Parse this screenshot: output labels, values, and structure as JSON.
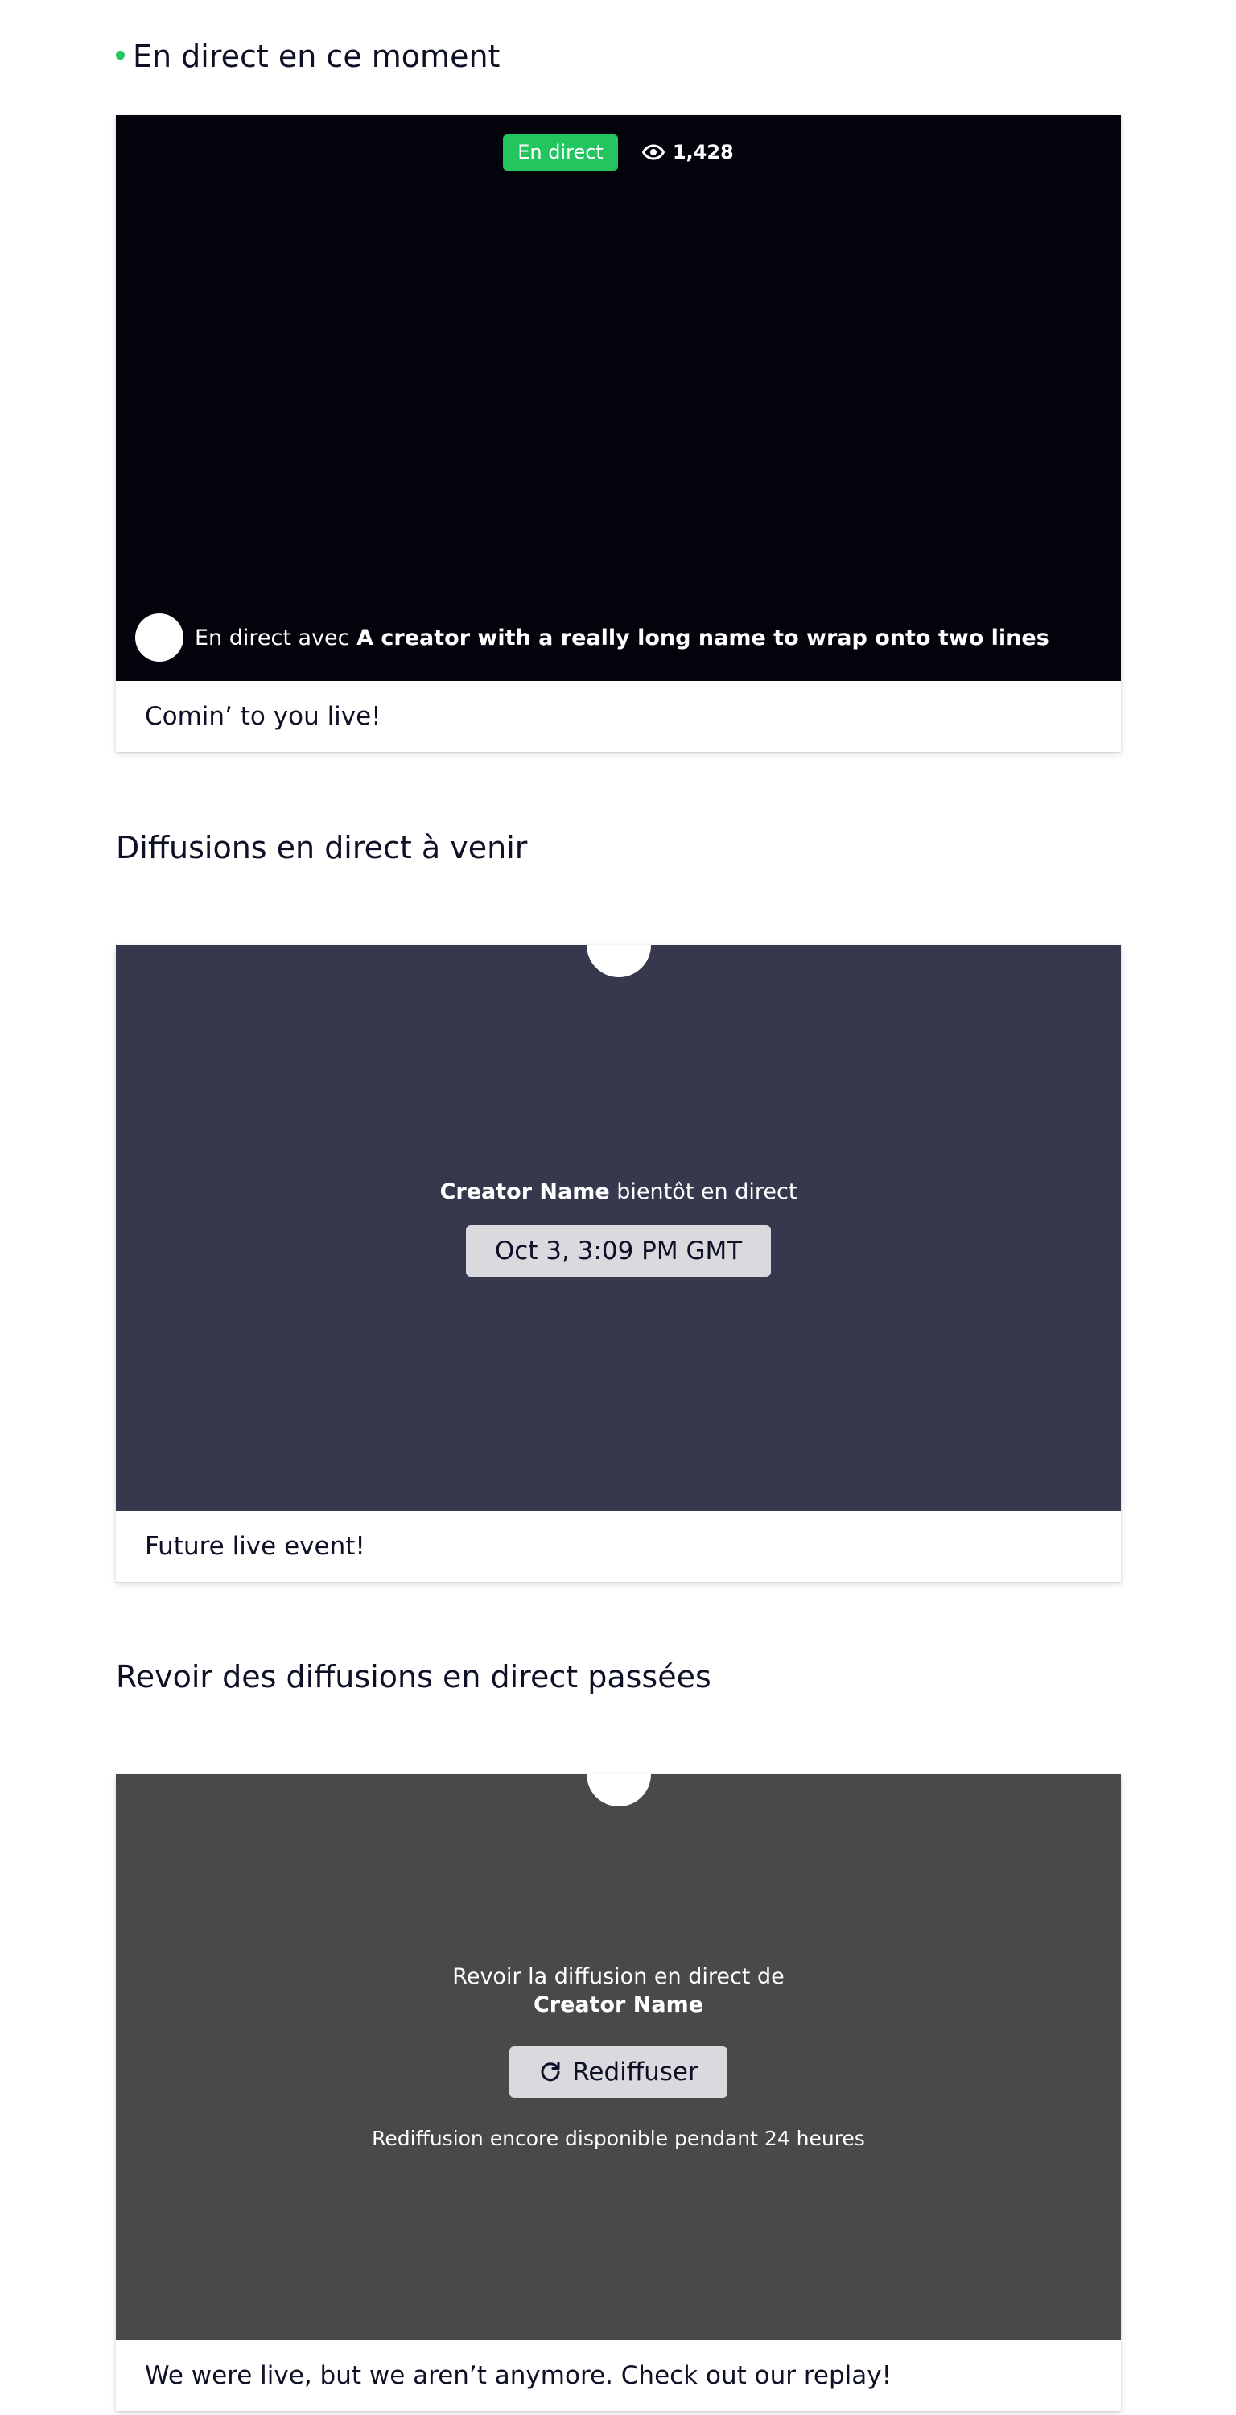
{
  "live_section": {
    "title": "En direct en ce moment",
    "badge": "En direct",
    "viewer_count": "1,428",
    "with_prefix": "En direct avec",
    "creator_name": "A creator with a really long name to wrap onto two lines",
    "caption": "Comin’ to you live!"
  },
  "upcoming_section": {
    "title": "Diffusions en direct à venir",
    "creator_name": "Creator Name",
    "status_text": "bientôt en direct",
    "scheduled_time": "Oct 3, 3:09 PM GMT",
    "caption": "Future live event!"
  },
  "past_section": {
    "title": "Revoir des diffusions en direct passées",
    "replay_intro": "Revoir la diffusion en direct de",
    "creator_name": "Creator Name",
    "replay_button": "Rediffuser",
    "availability_note": "Rediffusion encore disponible pendant 24 heures",
    "caption": "We were live, but we aren’t anymore. Check out our replay!"
  },
  "colors": {
    "live_green": "#22c55e",
    "live_bg": "#03030c",
    "upcoming_bg": "#36384e",
    "past_bg": "#494949",
    "pill_bg": "#d9d9de"
  },
  "icons": {
    "viewers": "eye-icon",
    "replay": "refresh-icon"
  }
}
